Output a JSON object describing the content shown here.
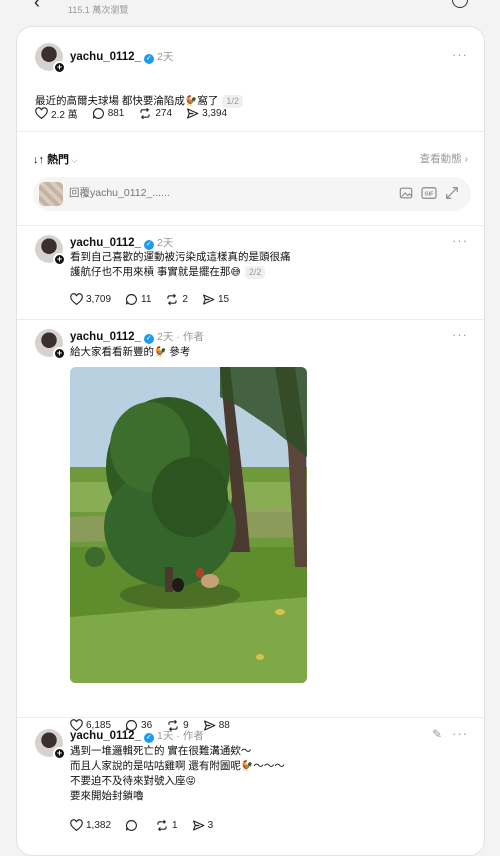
{
  "header": {
    "views_text": "115.1 萬次瀏覽"
  },
  "root_post": {
    "username": "yachu_0112_",
    "time": "2天",
    "text": "最近的高爾夫球場 都快要淪陷成",
    "text_tail": "窩了",
    "pager": "1/2",
    "likes": "2.2 萬",
    "comments": "881",
    "reposts": "274",
    "shares": "3,394"
  },
  "sort": {
    "label": "熱門",
    "activity_link": "查看動態 ›"
  },
  "reply_box": {
    "placeholder": "回覆yachu_0112_......"
  },
  "replies": [
    {
      "username": "yachu_0112_",
      "time": "2天",
      "text": "看到自己喜歡的運動被污染成這樣真的是頭很痛\n護航仔也不用來槓 事實就是擺在那",
      "pager": "2/2",
      "likes": "3,709",
      "comments": "11",
      "reposts": "2",
      "shares": "15"
    },
    {
      "username": "yachu_0112_",
      "time": "2天",
      "role": "作者",
      "text": "給大家看看新豐的",
      "text_tail": "參考",
      "likes": "6,185",
      "comments": "36",
      "reposts": "9",
      "shares": "88"
    },
    {
      "username": "yachu_0112_",
      "time": "1天",
      "role": "作者",
      "text_l1": "遇到一堆邏輯死亡的 實在很難溝通欸～",
      "text_l2": "而且人家說的是咕咕雞啊 還有附圖呢",
      "text_l2_tail": "～～～",
      "text_l3": "不要迫不及待來對號入座",
      "text_l4": "要來開始封鎖嚕",
      "likes": "1,382",
      "comments": "",
      "reposts": "1",
      "shares": "3"
    }
  ],
  "icons": {
    "heart": "heart-icon",
    "comment": "comment-icon",
    "repost": "repost-icon",
    "share": "share-icon",
    "more": "more-icon",
    "verified": "verified-icon",
    "chicken": "chicken-emoji-icon",
    "sweat": "sweat-smile-emoji-icon",
    "grin": "grin-emoji-icon"
  },
  "colors": {
    "verified": "#1d9bf0",
    "muted": "#999999",
    "text": "#101010"
  }
}
